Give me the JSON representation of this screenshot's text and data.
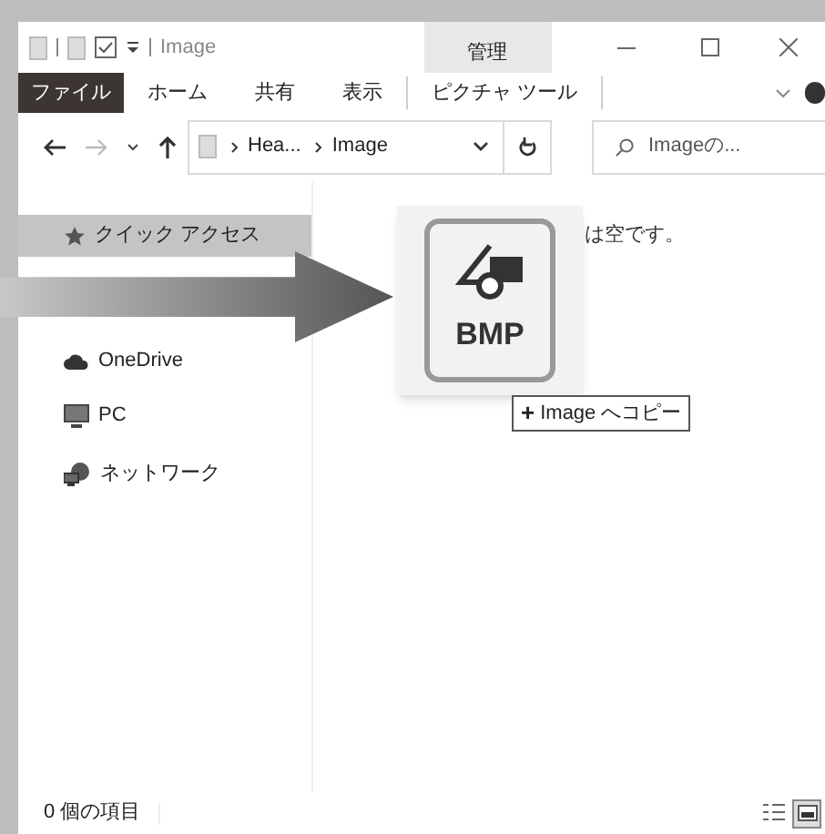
{
  "window": {
    "title": "Image",
    "context_tab": "管理"
  },
  "ribbon_tabs": [
    {
      "label": "ファイル",
      "selected": true
    },
    {
      "label": "ホーム",
      "selected": false
    },
    {
      "label": "共有",
      "selected": false
    },
    {
      "label": "表示",
      "selected": false
    },
    {
      "label": "ピクチャ ツール",
      "selected": false
    }
  ],
  "address_bar": {
    "path": [
      "Hea...",
      "Image"
    ]
  },
  "search": {
    "placeholder": "Imageの..."
  },
  "sidebar": {
    "items": [
      {
        "label": "クイック アクセス",
        "kind": "star",
        "selected": true
      },
      {
        "label": "OneDrive",
        "kind": "cloud",
        "selected": false
      },
      {
        "label": "PC",
        "kind": "pc",
        "selected": false
      },
      {
        "label": "ネットワーク",
        "kind": "network",
        "selected": false
      }
    ]
  },
  "content": {
    "empty_message": "は空です。"
  },
  "drag": {
    "file_type": "BMP",
    "tooltip": "Image へコピー",
    "tooltip_symbol": "+"
  },
  "status_bar": {
    "item_count": "0 個の項目",
    "views": [
      {
        "kind": "details",
        "selected": false
      },
      {
        "kind": "large",
        "selected": true
      }
    ]
  }
}
